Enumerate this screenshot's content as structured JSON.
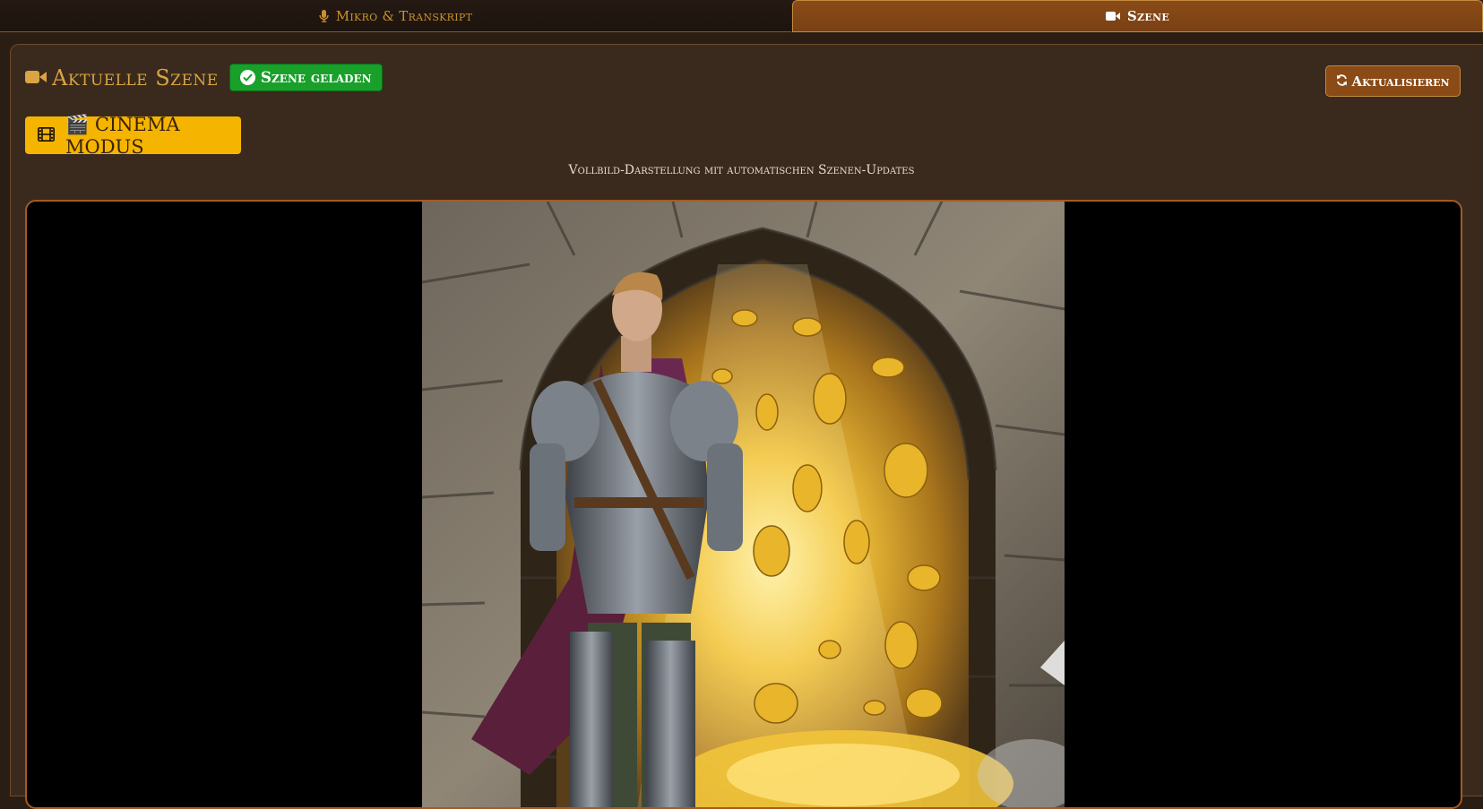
{
  "tabs": {
    "mikro_label": "Mikro & Transkript",
    "szene_label": "Szene",
    "active": "Szene"
  },
  "scene": {
    "title": "Aktuelle Szene",
    "status_badge": "Szene geladen",
    "refresh_label": "Aktualisieren",
    "cinema_label": "🎬 CINEMA MODUS",
    "subtitle": "Vollbild-Darstellung mit automatischen Szenen-Updates"
  },
  "colors": {
    "accent_gold": "#d9a441",
    "active_tab": "#8a4b17",
    "success": "#18a02a",
    "cinema": "#f5b400"
  },
  "icons": [
    "microphone-icon",
    "video-camera-icon",
    "check-circle-icon",
    "refresh-icon",
    "film-icon"
  ]
}
